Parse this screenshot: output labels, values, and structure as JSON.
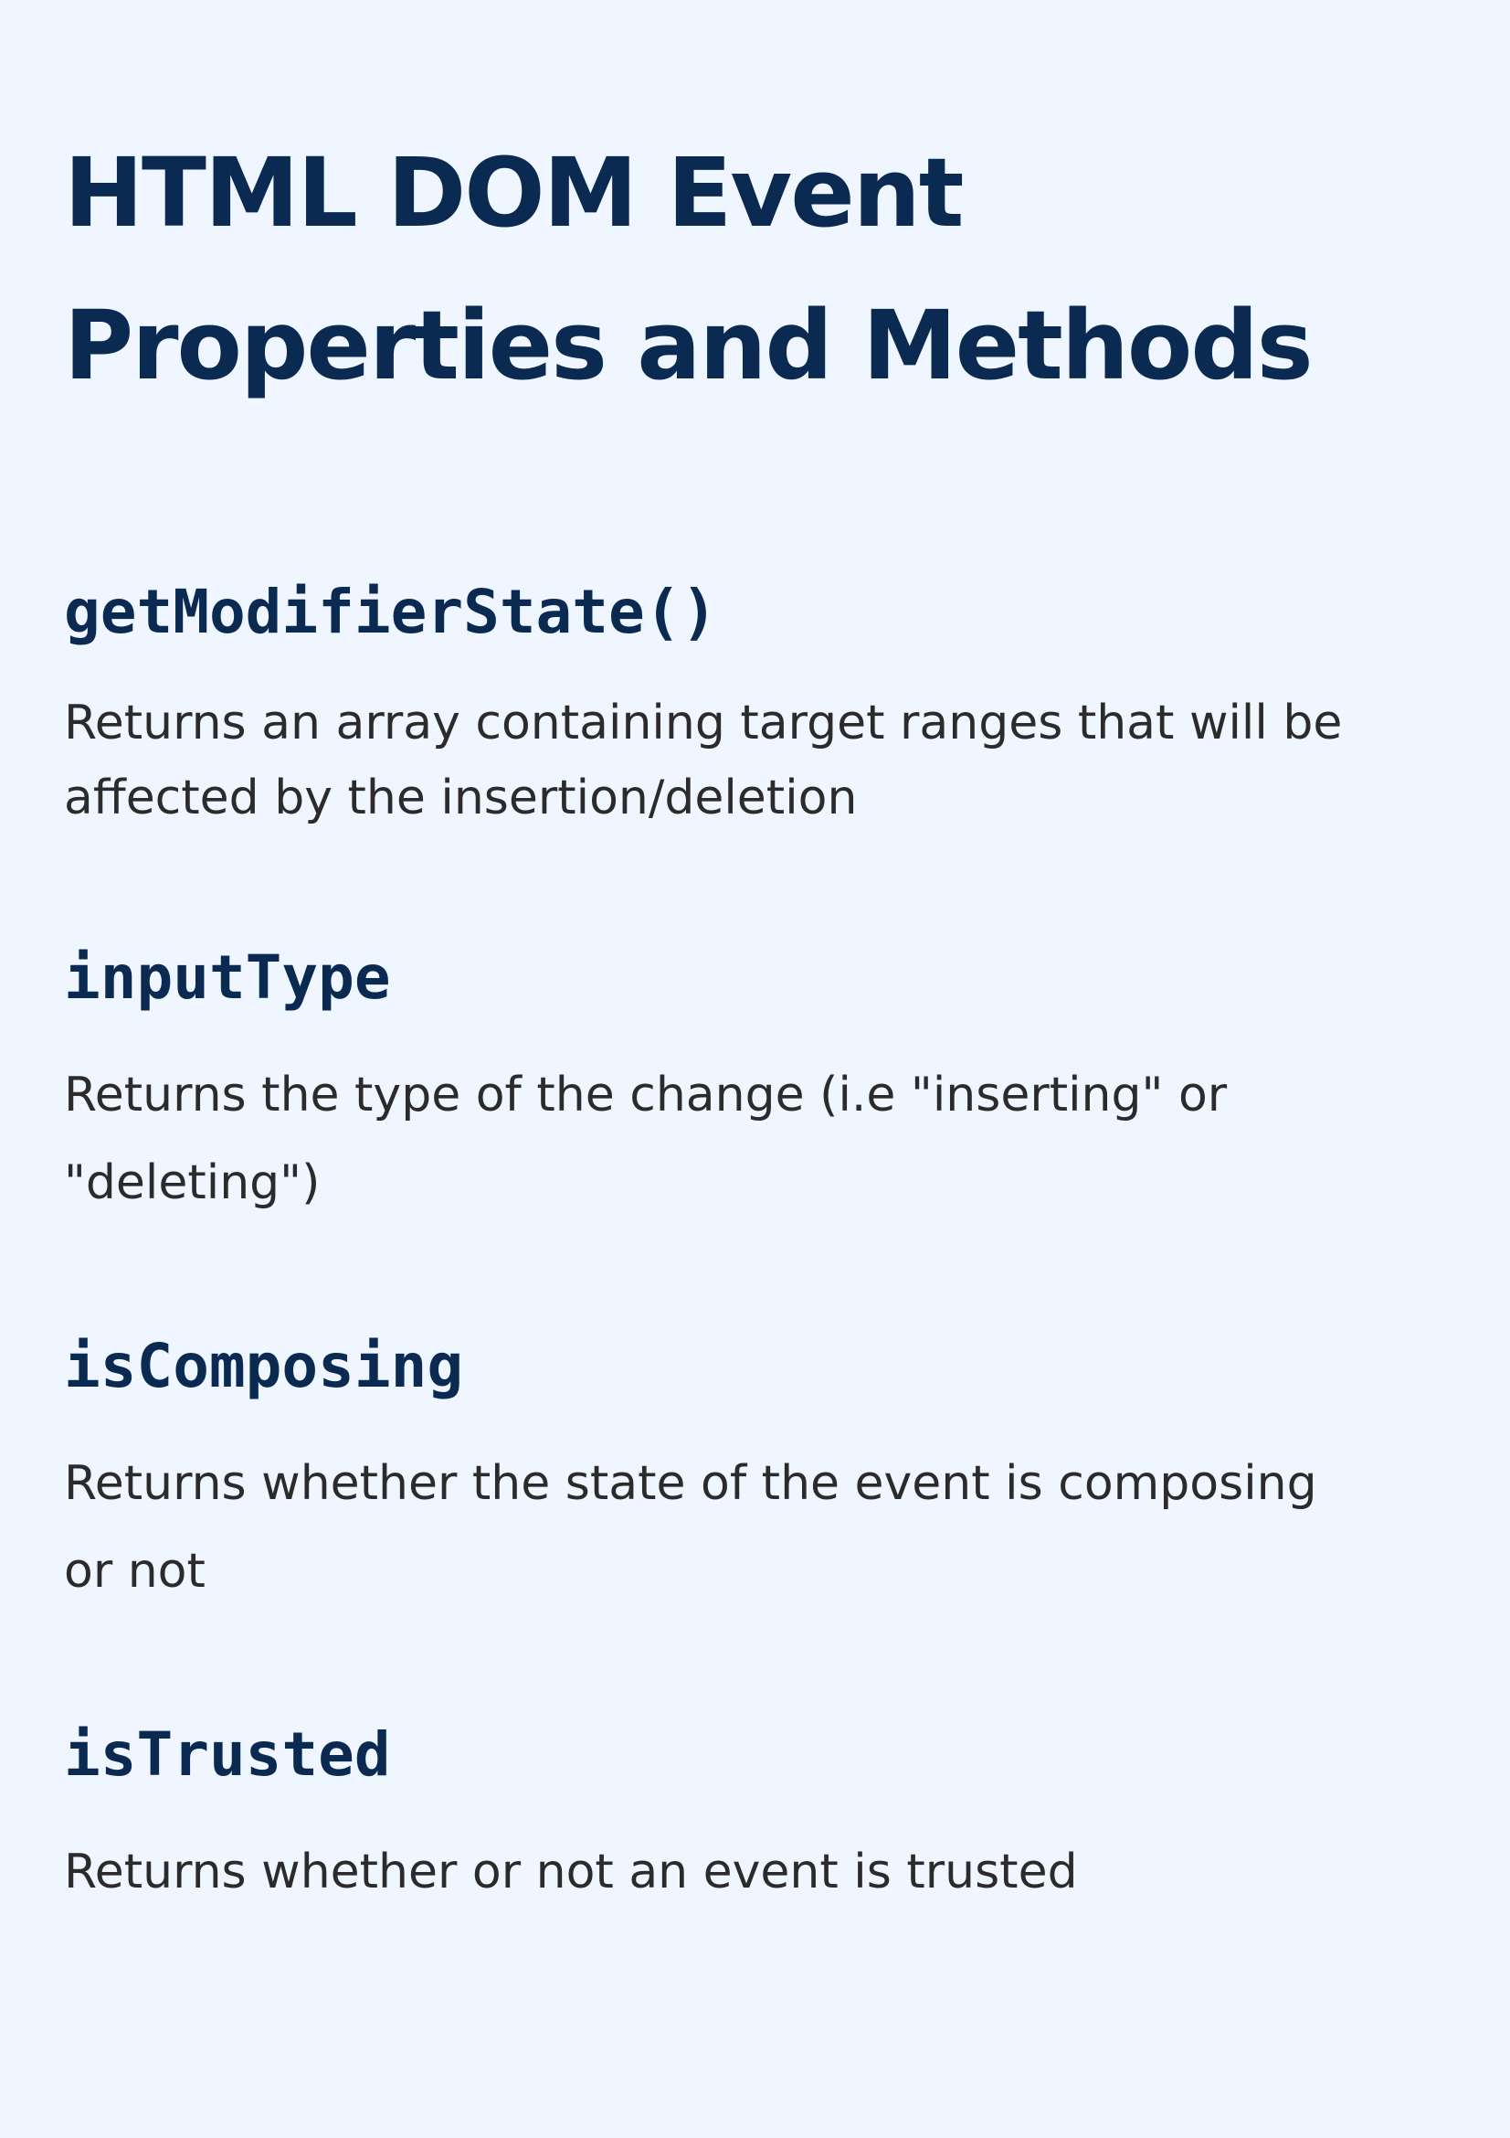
{
  "title": {
    "line1": "HTML DOM Event",
    "line2": "Properties and Methods"
  },
  "entries": [
    {
      "name": "getModifierState()",
      "description": [
        "Returns an array containing target ranges that will be",
        "affected by the insertion/deletion"
      ]
    },
    {
      "name": "inputType",
      "description": [
        "Returns the type of the change (i.e \"inserting\" or",
        "\"deleting\")"
      ]
    },
    {
      "name": "isComposing",
      "description": [
        "Returns whether the state of the event is composing",
        "or not"
      ]
    },
    {
      "name": "isTrusted",
      "description": [
        "Returns whether or not an event is trusted"
      ]
    }
  ],
  "colors": {
    "background": "#eff6ff",
    "heading": "#0a2a52",
    "body_text": "#2b2b2b"
  }
}
